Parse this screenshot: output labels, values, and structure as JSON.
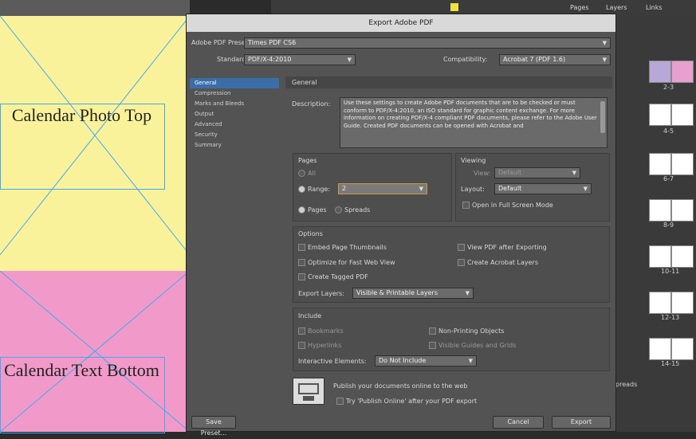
{
  "dialog": {
    "title": "Export Adobe PDF",
    "preset_label": "Adobe PDF Preset:",
    "preset_value": "Times PDF CS6",
    "standard_label": "Standard:",
    "standard_value": "PDF/X-4:2010",
    "compat_label": "Compatibility:",
    "compat_value": "Acrobat 7 (PDF 1.6)",
    "nav_items": [
      "General",
      "Compression",
      "Marks and Bleeds",
      "Output",
      "Advanced",
      "Security",
      "Summary"
    ],
    "section_title": "General",
    "description_label": "Description:",
    "description_text": "Use these settings to create Adobe PDF documents that are to be checked or must conform to PDF/X-4:2010, an ISO standard for graphic content exchange. For more information on creating PDF/X-4 compliant PDF documents, please refer to the Adobe User Guide. Created PDF documents can be opened with Acrobat and",
    "pages": {
      "title": "Pages",
      "all_label": "All",
      "range_label": "Range:",
      "range_value": "2",
      "pages_label": "Pages",
      "spreads_label": "Spreads"
    },
    "viewing": {
      "title": "Viewing",
      "view_label": "View:",
      "view_value": "Default",
      "layout_label": "Layout:",
      "layout_value": "Default",
      "fullscreen_label": "Open in Full Screen Mode"
    },
    "options": {
      "title": "Options",
      "embed_thumbs": "Embed Page Thumbnails",
      "view_after": "View PDF after Exporting",
      "optimize": "Optimize for Fast Web View",
      "create_layers": "Create Acrobat Layers",
      "tagged": "Create Tagged PDF",
      "export_layers_label": "Export Layers:",
      "export_layers_value": "Visible & Printable Layers"
    },
    "include": {
      "title": "Include",
      "bookmarks": "Bookmarks",
      "non_printing": "Non-Printing Objects",
      "hyperlinks": "Hyperlinks",
      "visible_guides": "Visible Guides and Grids",
      "interactive_label": "Interactive Elements:",
      "interactive_value": "Do Not Include"
    },
    "publish": {
      "line1": "Publish your documents online to the web",
      "line2": "Try 'Publish Online' after your PDF export"
    },
    "buttons": {
      "save_preset": "Save Preset...",
      "cancel": "Cancel",
      "export": "Export"
    }
  },
  "document": {
    "photo_frame_text": "Calendar Photo Top",
    "text_frame_text": "Calendar Text Bottom"
  },
  "pages_panel": {
    "labels": [
      "2-3",
      "4-5",
      "6-7",
      "8-9",
      "10-11",
      "12-13",
      "14-15"
    ],
    "tab_labels": [
      "Pages",
      "Layers",
      "Links"
    ],
    "footer_label": "preads"
  },
  "colors": {
    "yellow_page": "#faf29a",
    "pink_page": "#f19ac9",
    "selection_blue": "#3b6ea8",
    "frame_blue": "#3fa9f5"
  }
}
